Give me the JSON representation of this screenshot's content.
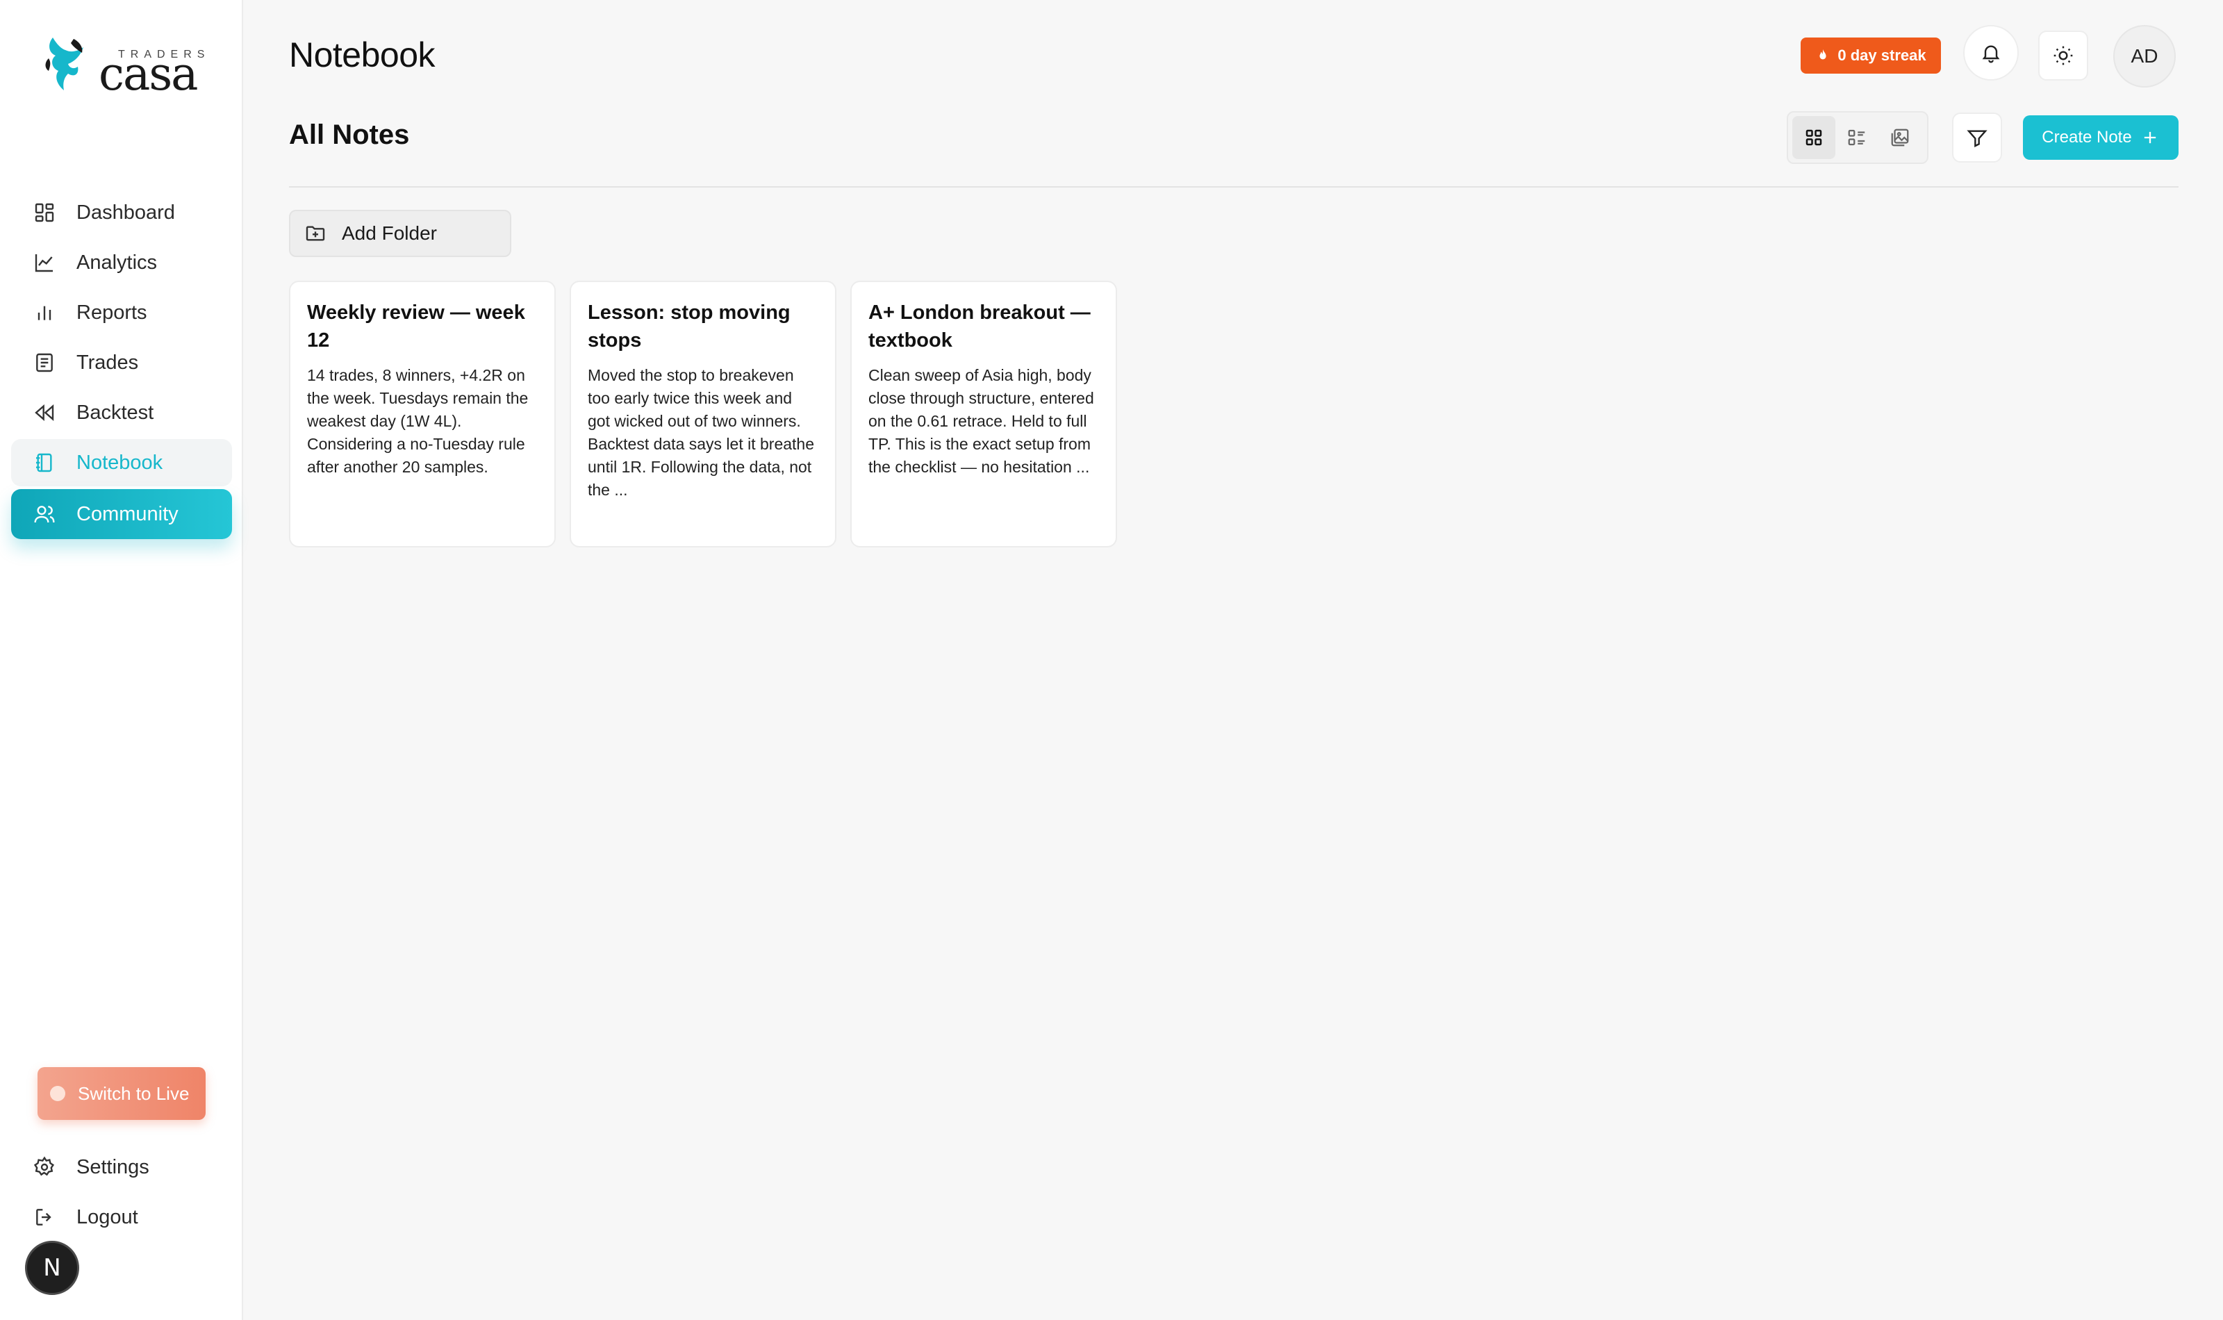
{
  "brand": {
    "traders": "TRADERS",
    "casa": "casa"
  },
  "sidebar": {
    "items": [
      {
        "label": "Dashboard"
      },
      {
        "label": "Analytics"
      },
      {
        "label": "Reports"
      },
      {
        "label": "Trades"
      },
      {
        "label": "Backtest"
      },
      {
        "label": "Notebook"
      },
      {
        "label": "Community"
      }
    ],
    "switch_live": "Switch to Live",
    "bottom_items": [
      {
        "label": "Settings"
      },
      {
        "label": "Logout"
      }
    ],
    "fab_letter": "N"
  },
  "header": {
    "title": "Notebook",
    "streak": "0 day streak",
    "avatar_initials": "AD"
  },
  "notes": {
    "section_title": "All Notes",
    "create_label": "Create Note",
    "add_folder_label": "Add Folder",
    "view_modes": [
      "grid",
      "list",
      "gallery"
    ],
    "selected_view": "grid",
    "cards": [
      {
        "title": "Weekly review — week 12",
        "body": "14 trades, 8 winners, +4.2R on the week. Tuesdays remain the weakest day (1W 4L). Considering a no-Tuesday rule after another 20 samples."
      },
      {
        "title": "Lesson: stop moving stops",
        "body": "Moved the stop to breakeven too early twice this week and got wicked out of two winners. Backtest data says let it breathe until 1R. Following the data, not the ..."
      },
      {
        "title": "A+ London breakout — textbook",
        "body": "Clean sweep of Asia high, body close through structure, entered on the 0.61 retrace. Held to full TP. This is the exact setup from the checklist — no hesitation ..."
      }
    ]
  },
  "colors": {
    "accent": "#1bc0d2",
    "streak": "#ef5a1b",
    "switch_live": "#ef8468"
  }
}
